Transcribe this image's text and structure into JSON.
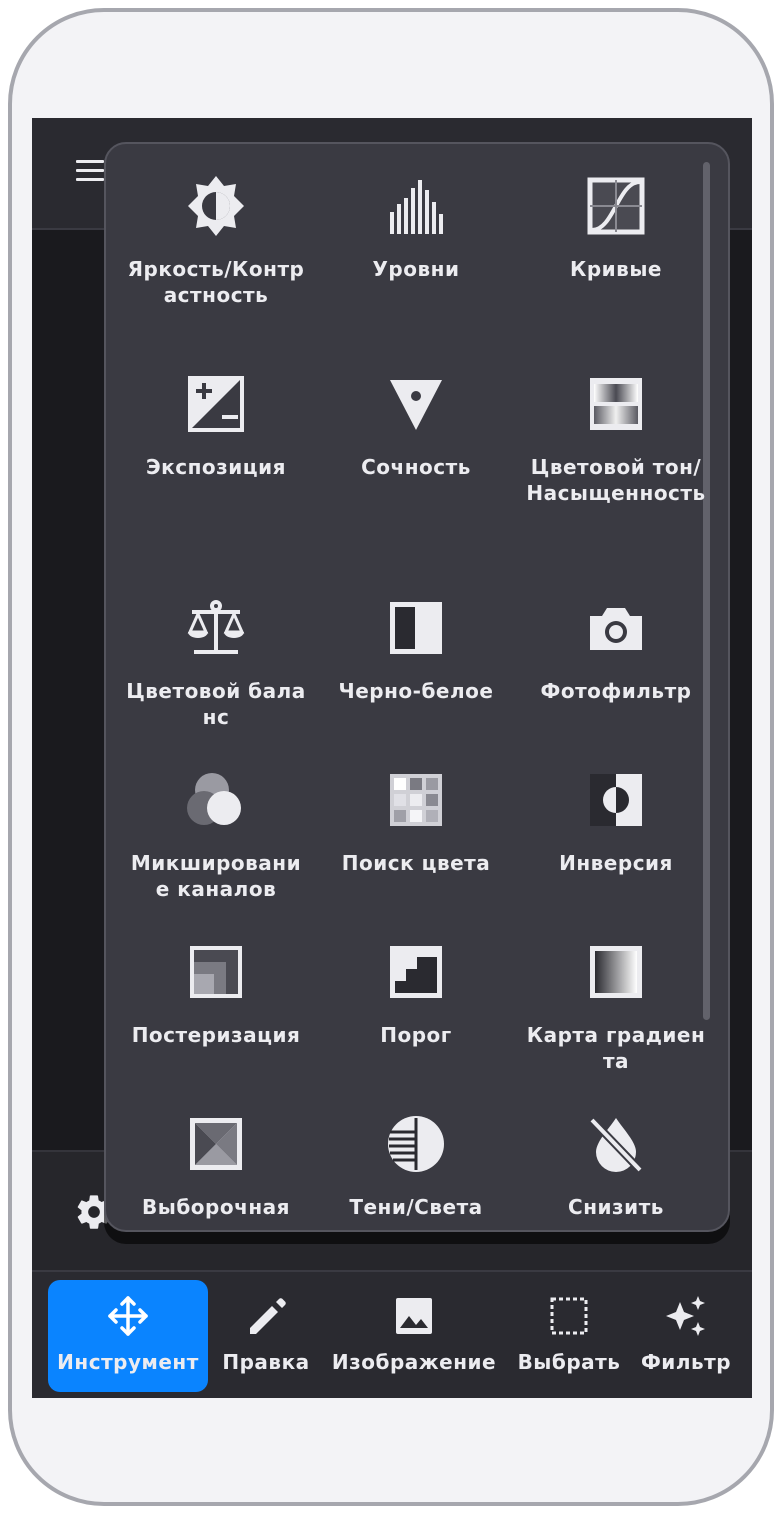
{
  "menu": {
    "items": [
      {
        "label": "Яркость/Контрастность",
        "icon": "brightness-contrast-icon"
      },
      {
        "label": "Уровни",
        "icon": "levels-icon"
      },
      {
        "label": "Кривые",
        "icon": "curves-icon"
      },
      {
        "label": "Экспозиция",
        "icon": "exposure-icon"
      },
      {
        "label": "Сочность",
        "icon": "vibrance-icon"
      },
      {
        "label": "Цветовой тон/Насыщенность",
        "icon": "hue-saturation-icon"
      },
      {
        "label": "Цветовой баланс",
        "icon": "color-balance-icon"
      },
      {
        "label": "Черно-белое",
        "icon": "black-white-icon"
      },
      {
        "label": "Фотофильтр",
        "icon": "camera-icon"
      },
      {
        "label": "Микширование каналов",
        "icon": "channel-mixer-icon"
      },
      {
        "label": "Поиск цвета",
        "icon": "color-lookup-icon"
      },
      {
        "label": "Инверсия",
        "icon": "invert-icon"
      },
      {
        "label": "Постеризация",
        "icon": "posterize-icon"
      },
      {
        "label": "Порог",
        "icon": "threshold-icon"
      },
      {
        "label": "Карта градиента",
        "icon": "gradient-map-icon"
      },
      {
        "label": "Выборочная",
        "icon": "selective-color-icon"
      },
      {
        "label": "Тени/Света",
        "icon": "shadows-highlights-icon"
      },
      {
        "label": "Снизить",
        "icon": "desaturate-icon"
      }
    ]
  },
  "nav": {
    "items": [
      {
        "label": "Инструмент",
        "icon": "move-icon",
        "active": true
      },
      {
        "label": "Правка",
        "icon": "pencil-icon",
        "active": false
      },
      {
        "label": "Изображение",
        "icon": "image-icon",
        "active": false
      },
      {
        "label": "Выбрать",
        "icon": "selection-icon",
        "active": false
      },
      {
        "label": "Фильтр",
        "icon": "sparkles-icon",
        "active": false
      }
    ]
  },
  "colors": {
    "accent": "#0a84ff",
    "panel": "#3a3a42",
    "background": "#1c1c20"
  }
}
